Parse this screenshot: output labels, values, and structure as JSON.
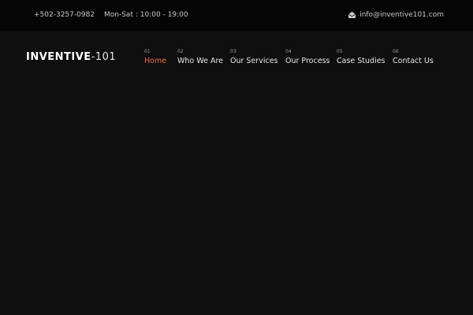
{
  "topbar": {
    "phone": "+502-3257-0982",
    "hours": "Mon-Sat : 10:00 - 19:00",
    "email": "info@inventive101.com",
    "email_icon": "envelope-open-icon"
  },
  "logo": {
    "brand": "INVENTIVE",
    "suffix": "-101"
  },
  "nav": {
    "active_color": "#f06b4e",
    "items": [
      {
        "num": "01",
        "label": "Home"
      },
      {
        "num": "02",
        "label": "Who We Are"
      },
      {
        "num": "03",
        "label": "Our Services"
      },
      {
        "num": "04",
        "label": "Our Process"
      },
      {
        "num": "05",
        "label": "Case Studies"
      },
      {
        "num": "06",
        "label": "Contact Us"
      }
    ]
  }
}
